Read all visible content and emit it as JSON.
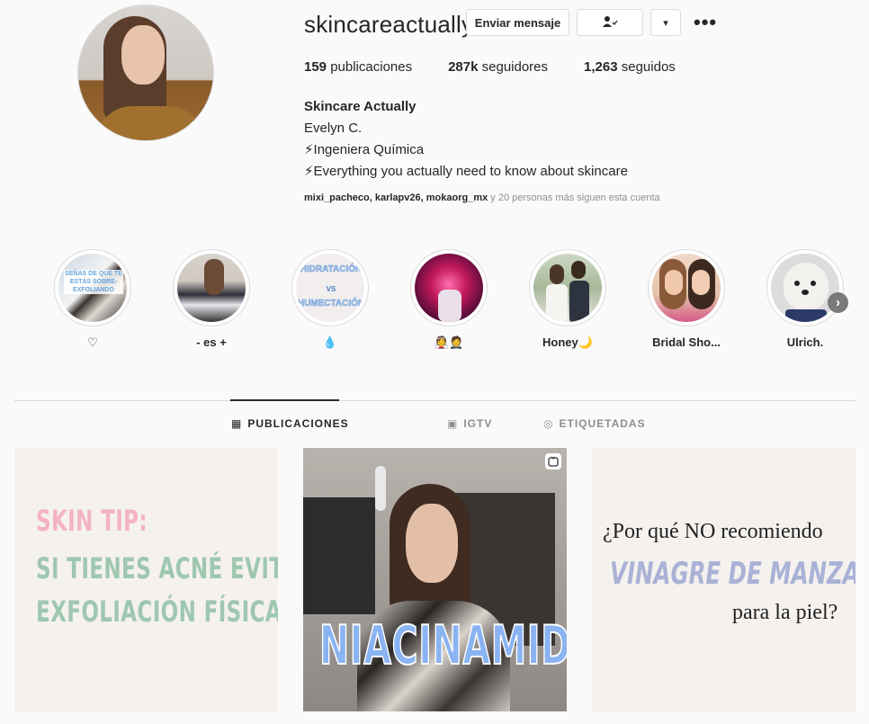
{
  "profile": {
    "username": "skincareactually",
    "send_message_label": "Enviar mensaje",
    "follow_icon": "person-check-icon",
    "more_icon": "more-dots-icon",
    "more_label": "•••",
    "dropdown_label": "▾",
    "stats": {
      "posts_count": "159",
      "posts_label": " publicaciones",
      "followers_count": "287k",
      "followers_label": " seguidores",
      "following_count": "1,263",
      "following_label": " seguidos"
    },
    "bio": {
      "full_name": "Skincare Actually",
      "line1": "Evelyn C.",
      "line2": "⚡Ingeniera Química",
      "line3": "⚡Everything you actually need to know about skincare"
    },
    "followed_by": {
      "names": "mixi_pacheco, karlapv26, mokaorg_mx",
      "suffix": " y 20 personas más siguen esta cuenta"
    }
  },
  "stories": [
    {
      "label": "♡",
      "thumb_text": "SEÑAS DE QUE TE ESTÁS SOBRE-EXFOLIANDO"
    },
    {
      "label": "- es +"
    },
    {
      "label": "💧",
      "thumb_text_top": "HIDRATACIÓN",
      "thumb_text_mid": "VS",
      "thumb_text_bottom": "HUMECTACIÓN"
    },
    {
      "label": "👰🤵"
    },
    {
      "label": "Honey🌙"
    },
    {
      "label": "Bridal Sho..."
    },
    {
      "label": "Ulrich."
    }
  ],
  "tabs": [
    {
      "label": "PUBLICACIONES",
      "icon": "grid-icon",
      "glyph": "▦"
    },
    {
      "label": "IGTV",
      "icon": "igtv-icon",
      "glyph": "▣"
    },
    {
      "label": "ETIQUETADAS",
      "icon": "tagged-icon",
      "glyph": "◎"
    }
  ],
  "posts": {
    "post1": {
      "line1": "SKIN TIP:",
      "line2": "SI TIENES ACNÉ EVITA LA",
      "line3": "EXFOLIACIÓN FÍSICA"
    },
    "post2": {
      "title": "NIACINAMIDA",
      "badge_icon": "igtv-badge-icon"
    },
    "post3": {
      "line1": "¿Por qué NO recomiendo",
      "line2": "VINAGRE DE MANZANA",
      "line3": "para la piel?"
    }
  },
  "colors": {
    "skin_tip_pink": "#f4b3c2",
    "skin_tip_green": "#9fc7b0",
    "vinagre_blue": "#a9b2d6",
    "niacinamida_blue": "#8ab3f2"
  }
}
